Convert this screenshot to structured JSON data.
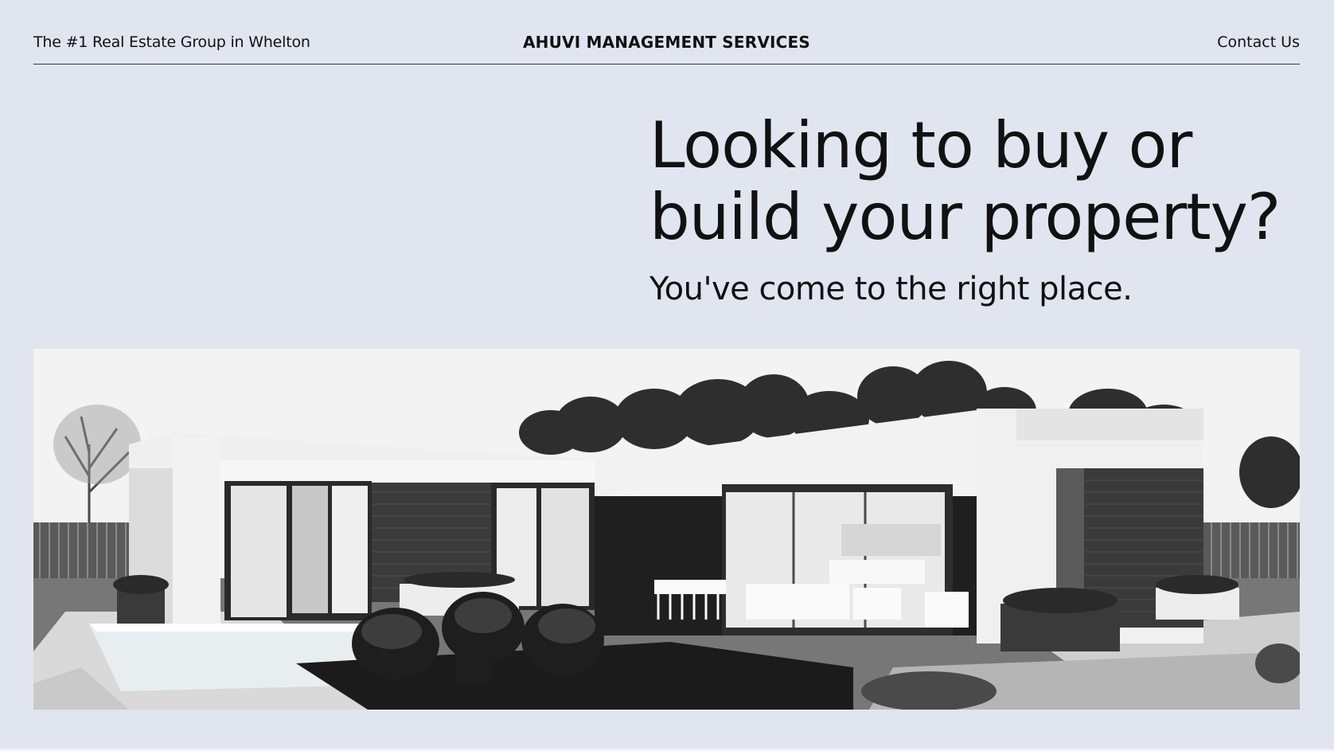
{
  "header": {
    "tagline": "The #1 Real Estate Group in Whelton",
    "brand": "AHUVI MANAGEMENT SERVICES",
    "contact_label": "Contact Us"
  },
  "hero": {
    "headline_line1": "Looking to buy or",
    "headline_line2": "build your property?",
    "subheadline": "You've come to the right place."
  },
  "image": {
    "subject": "modern-single-story-house-grayscale"
  },
  "colors": {
    "background": "#e1e5ef",
    "text": "#111111",
    "rule": "#3a3a3a"
  }
}
